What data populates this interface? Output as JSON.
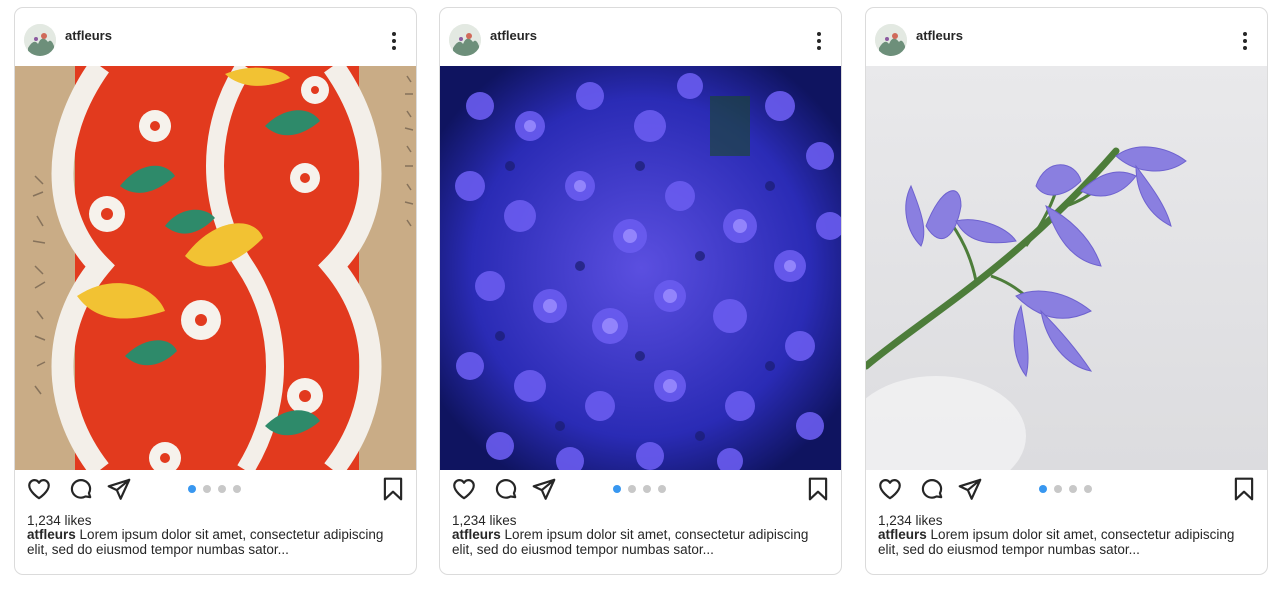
{
  "posts": [
    {
      "username": "atfleurs",
      "image": "textile-floral-pattern",
      "likes": "1,234 likes",
      "caption_user": "atfleurs",
      "caption_text": "Lorem ipsum dolor sit amet, consectetur adipiscing elit, sed do eiusmod tempor numbas sator...",
      "carousel_count": 4,
      "carousel_active": 1
    },
    {
      "username": "atfleurs",
      "image": "blue-hydrangea",
      "likes": "1,234 likes",
      "caption_user": "atfleurs",
      "caption_text": "Lorem ipsum dolor sit amet, consectetur adipiscing elit, sed do eiusmod tempor numbas sator...",
      "carousel_count": 4,
      "carousel_active": 1
    },
    {
      "username": "atfleurs",
      "image": "purple-hyacinth-stem",
      "likes": "1,234 likes",
      "caption_user": "atfleurs",
      "caption_text": "Lorem ipsum dolor sit amet, consectetur adipiscing elit, sed do eiusmod tempor numbas sator...",
      "carousel_count": 4,
      "carousel_active": 1
    }
  ],
  "icons": {
    "more": "more-vertical-icon",
    "like": "heart-icon",
    "comment": "comment-icon",
    "share": "send-icon",
    "save": "bookmark-icon"
  },
  "colors": {
    "text": "#262626",
    "border": "#dbdbdb",
    "active_dot": "#3897f0",
    "inactive_dot": "#c8c8c8"
  }
}
